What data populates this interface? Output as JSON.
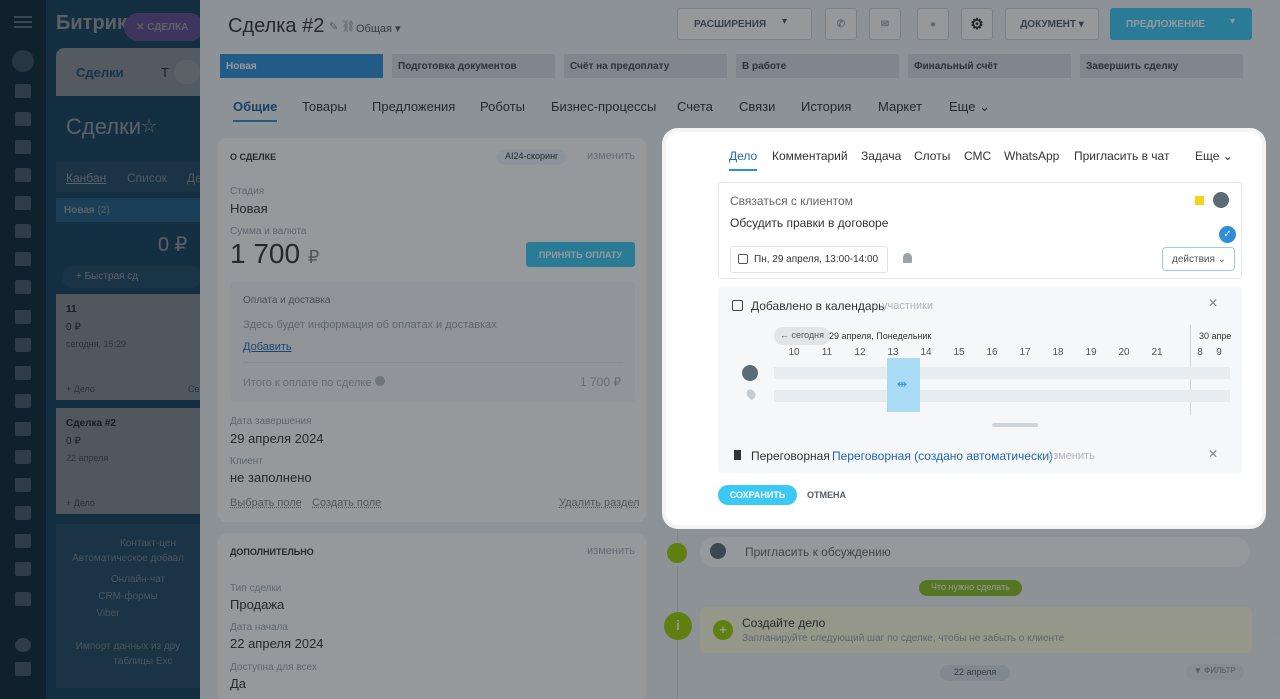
{
  "bg": {
    "brand": "Битрик",
    "chip_deal": "СДЕЛКА",
    "tab_deals": "Сделки",
    "tab_t": "Т",
    "page_title": "Сделки",
    "view_kanban": "Канбан",
    "view_list": "Список",
    "view_de": "Де",
    "col_new": "Новая",
    "col_new_count": "(2)",
    "col_sum": "0 ₽",
    "quick_deal": "+ Быстрая сд",
    "card1": {
      "title": "11",
      "sum": "0 ₽",
      "date": "сегодня, 15:29",
      "add": "+ Дело",
      "side": "Се"
    },
    "card2": {
      "title": "Сделка #2",
      "sum": "0 ₽",
      "date": "22 апреля",
      "add": "+ Дело"
    },
    "contact_center": "Контакт-цен",
    "auto_add": "Автоматическое добавл",
    "online_chat": "Онлайн-чат",
    "crm_forms": "CRM-формы",
    "viber": "Viber",
    "import1": "Импорт данных из дру",
    "import2": "таблицы Exc"
  },
  "header": {
    "title": "Сделка #2",
    "category": "Общая",
    "extensions": "РАСШИРЕНИЯ",
    "document": "ДОКУМЕНТ",
    "offer": "ПРЕДЛОЖЕНИЕ"
  },
  "stages": [
    "Новая",
    "Подготовка документов",
    "Счёт на предоплату",
    "В работе",
    "Финальный счёт",
    "Завершить сделку"
  ],
  "tabs": [
    "Общие",
    "Товары",
    "Предложения",
    "Роботы",
    "Бизнес-процессы",
    "Счета",
    "Связи",
    "История",
    "Маркет",
    "Еще"
  ],
  "about": {
    "title": "О СДЕЛКЕ",
    "scoring": "AI24-скоринг",
    "change": "изменить",
    "stage_label": "Стадия",
    "stage_value": "Новая",
    "sum_label": "Сумма и валюта",
    "sum_value": "1 700",
    "currency": "₽",
    "accept_payment": "ПРИНЯТЬ ОПЛАТУ",
    "payment_title": "Оплата и доставка",
    "payment_info": "Здесь будет информация об оплатах и доставках",
    "add": "Добавить",
    "total_label": "Итого к оплате по сделке",
    "total_value": "1 700 ₽",
    "close_date_label": "Дата завершения",
    "close_date": "29 апреля 2024",
    "client_label": "Клиент",
    "client_value": "не заполнено",
    "choose_field": "Выбрать поле",
    "create_field": "Создать поле",
    "delete_section": "Удалить раздел"
  },
  "extra": {
    "title": "ДОПОЛНИТЕЛЬНО",
    "change": "изменить",
    "type_label": "Тип сделки",
    "type_value": "Продажа",
    "start_label": "Дата начала",
    "start_value": "22 апреля 2024",
    "access_label": "Доступна для всех",
    "access_value": "Да"
  },
  "popup": {
    "tabs": [
      "Дело",
      "Комментарий",
      "Задача",
      "Слоты",
      "СМС",
      "WhatsApp",
      "Пригласить в чат"
    ],
    "more": "Еще",
    "subject": "Связаться с клиентом",
    "body": "Обсудить правки в договоре",
    "datetime": "Пн, 29 апреля, 13:00-14:00",
    "actions": "действия",
    "cal_title": "Добавлено в календарь",
    "participants": "участники",
    "today_btn": "← сегодня",
    "day_label": "29 апреля, Понедельник",
    "next_day": "30 апре",
    "hours": [
      "10",
      "11",
      "12",
      "13",
      "14",
      "15",
      "16",
      "17",
      "18",
      "19",
      "20",
      "21"
    ],
    "hours_next": [
      "8",
      "9"
    ],
    "room_label": "Переговорная",
    "room_value": "Переговорная (создано автоматически)",
    "room_change": "изменить",
    "save": "СОХРАНИТЬ",
    "cancel": "ОТМЕНА"
  },
  "timeline": {
    "invite": "Пригласить к обсуждению",
    "todo_badge": "Что нужно сделать",
    "create_title": "Создайте дело",
    "create_hint": "Запланируйте следующий шаг по сделке, чтобы не забыть о клиенте",
    "date_badge": "22 апреля",
    "filter": "ФИЛЬТР"
  },
  "colors": {
    "accent": "#2fc6f6",
    "green": "#9dcf00",
    "rail": "#0e2b45",
    "stage_active": "#2f8fd6"
  }
}
